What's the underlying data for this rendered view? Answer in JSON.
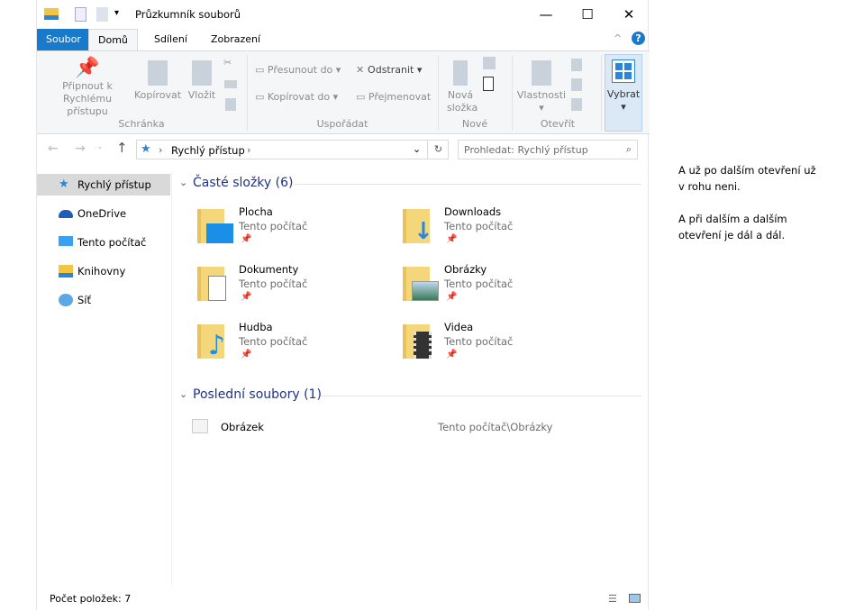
{
  "window": {
    "title": "Průzkumník souborů",
    "minimize": "—",
    "maximize": "☐",
    "close": "✕"
  },
  "tabs": [
    {
      "label": "Soubor"
    },
    {
      "label": "Domů"
    },
    {
      "label": "Sdílení"
    },
    {
      "label": "Zobrazení"
    }
  ],
  "ribbon": {
    "clipboard": {
      "group": "Schránka",
      "pin": "Připnout k Rychlému přístupu",
      "copy": "Kopírovat",
      "paste": "Vložit"
    },
    "organize": {
      "group": "Uspořádat",
      "move": "Přesunout do",
      "copyto": "Kopírovat do",
      "delete": "Odstranit",
      "rename": "Přejmenovat"
    },
    "new": {
      "group": "Nové",
      "folder": "Nová složka"
    },
    "open": {
      "group": "Otevřít",
      "properties": "Vlastnosti"
    },
    "select": {
      "label": "Vybrat"
    }
  },
  "address": {
    "path": "Rychlý přístup",
    "search_placeholder": "Prohledat: Rychlý přístup"
  },
  "nav": [
    {
      "label": "Rychlý přístup"
    },
    {
      "label": "OneDrive"
    },
    {
      "label": "Tento počítač"
    },
    {
      "label": "Knihovny"
    },
    {
      "label": "Síť"
    }
  ],
  "frequent": {
    "header": "Časté složky (6)",
    "items": [
      {
        "name": "Plocha",
        "location": "Tento počítač"
      },
      {
        "name": "Downloads",
        "location": "Tento počítač"
      },
      {
        "name": "Dokumenty",
        "location": "Tento počítač"
      },
      {
        "name": "Obrázky",
        "location": "Tento počítač"
      },
      {
        "name": "Hudba",
        "location": "Tento počítač"
      },
      {
        "name": "Videa",
        "location": "Tento počítač"
      }
    ]
  },
  "recent": {
    "header": "Poslední soubory (1)",
    "items": [
      {
        "name": "Obrázek",
        "path": "Tento počítač\\Obrázky"
      }
    ]
  },
  "status": {
    "count": "Počet položek: 7"
  },
  "note": {
    "p1": "A už po dalším otevření už v rohu neni.",
    "p2": "A při dalším a dalším otevření je dál a dál."
  }
}
